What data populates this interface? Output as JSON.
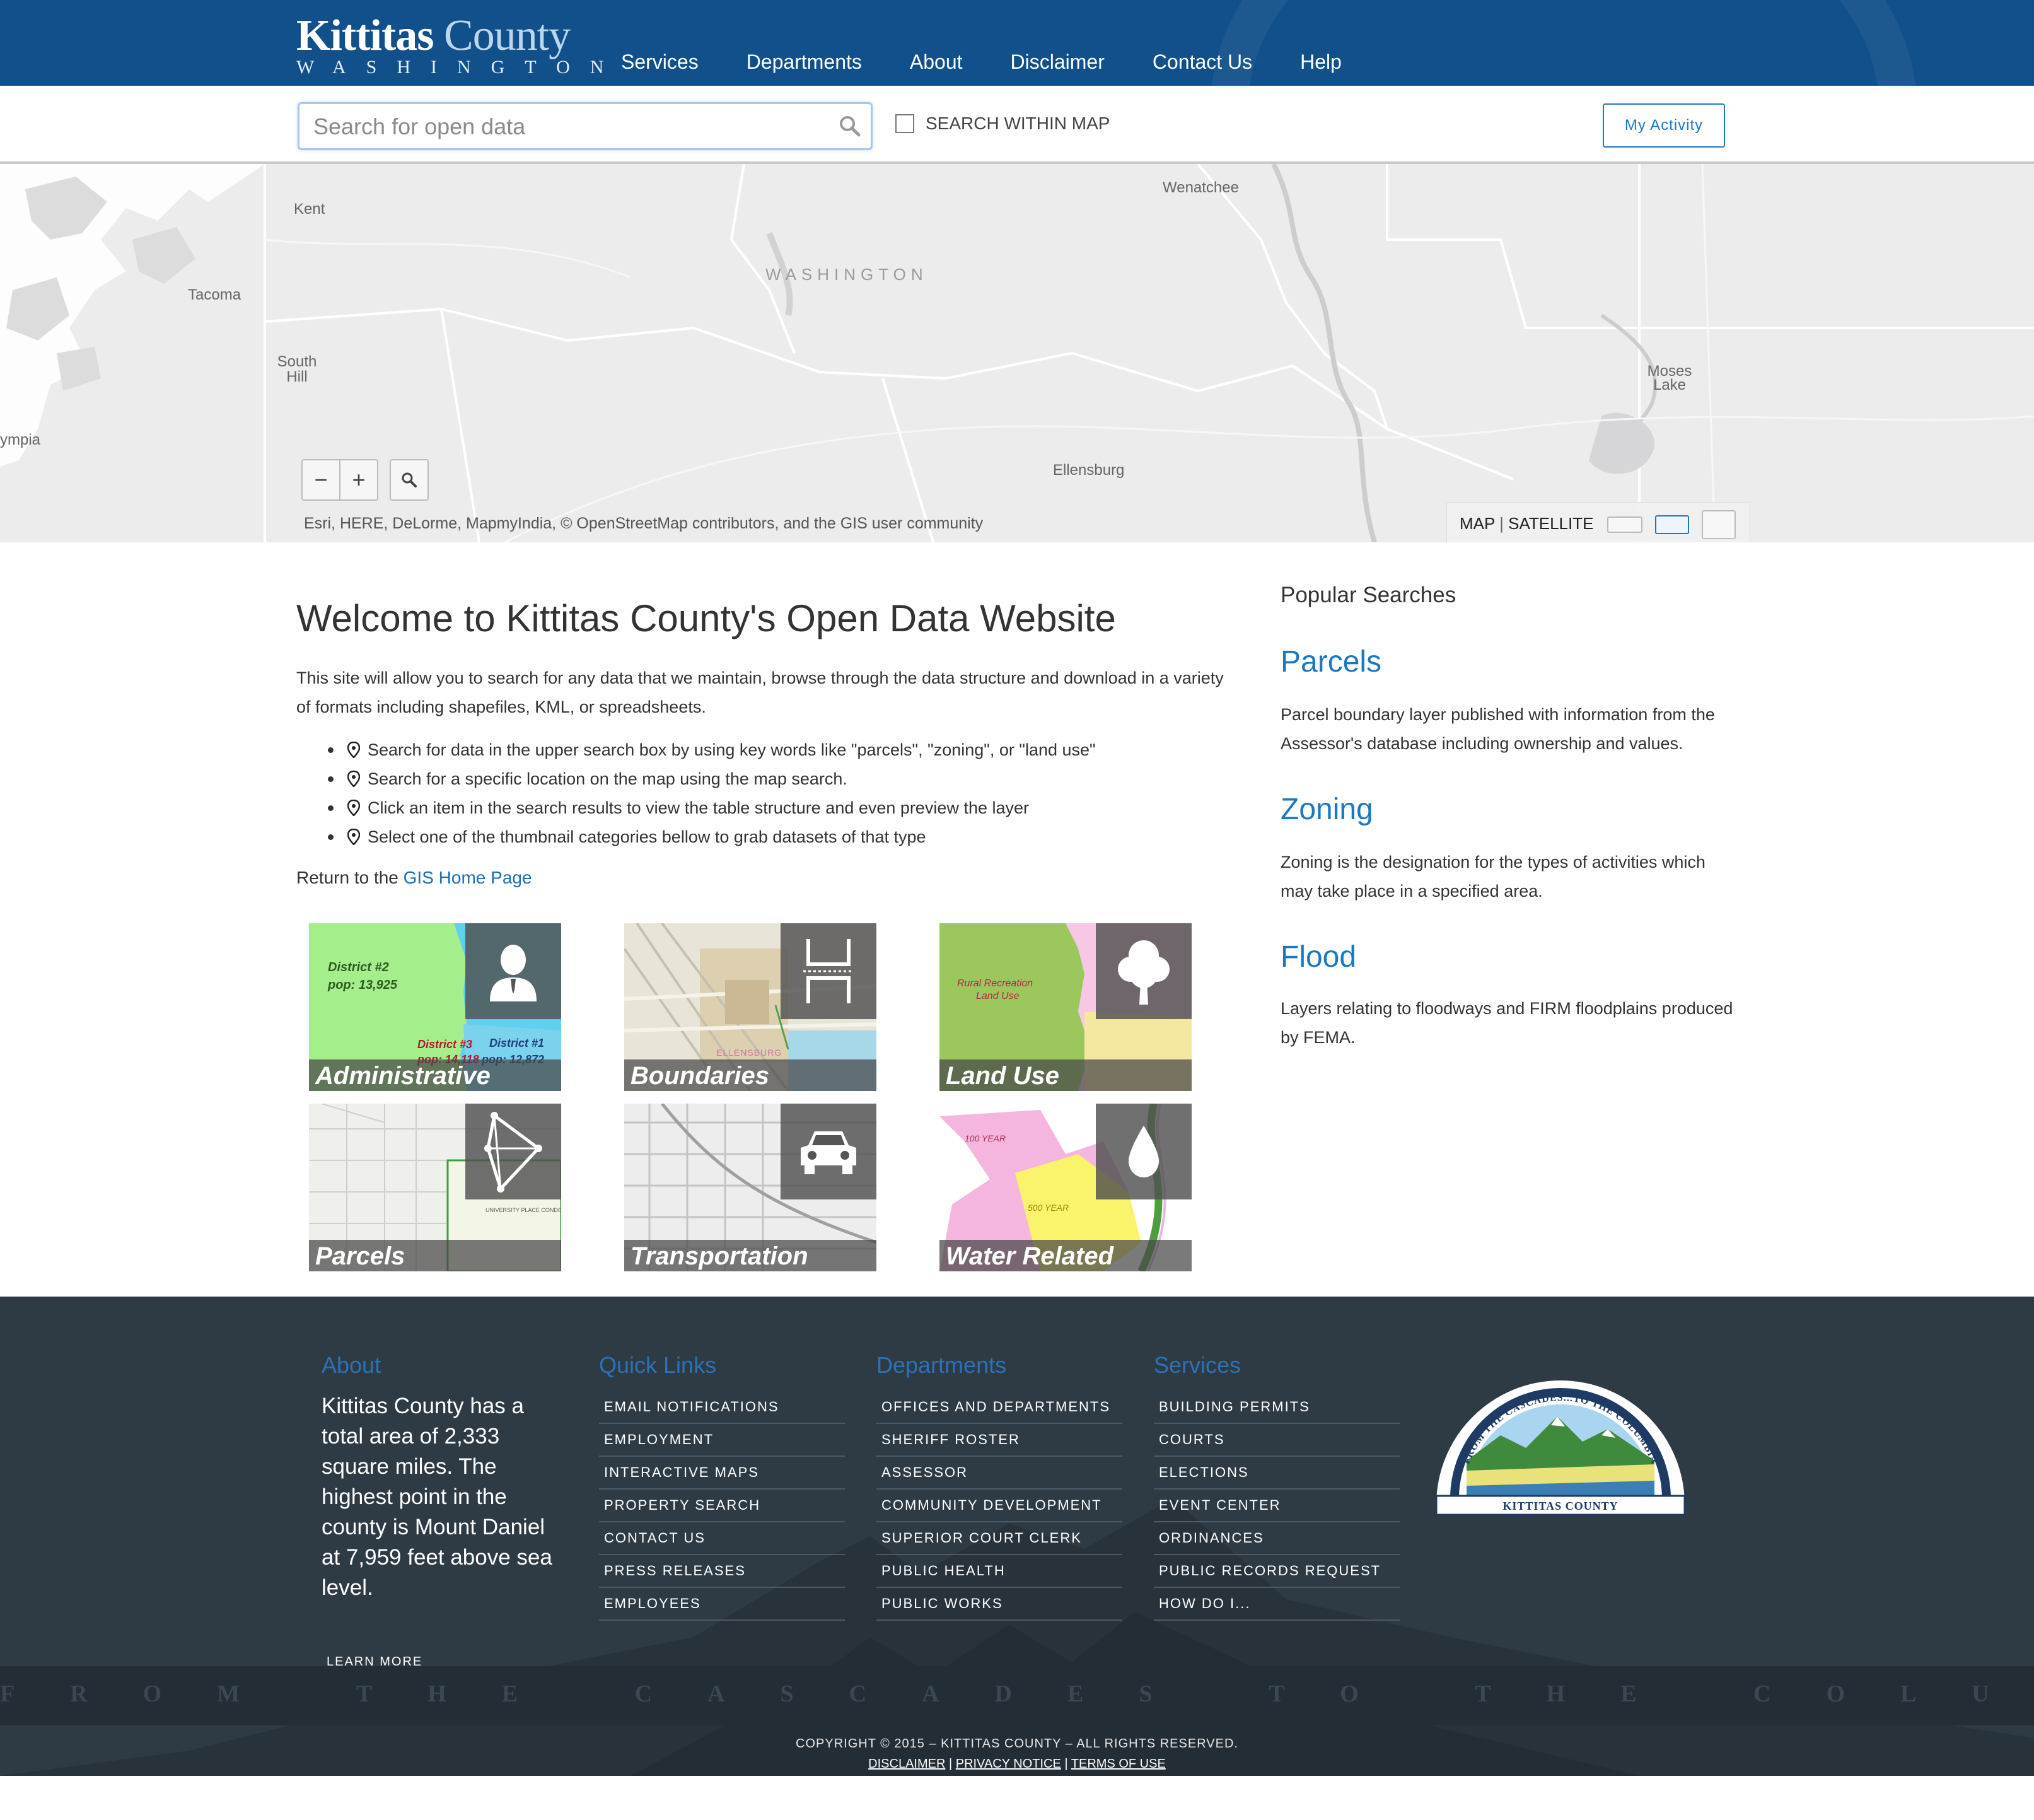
{
  "header": {
    "logo_title_1": "Kittitas",
    "logo_title_2": "County",
    "logo_subtitle": "WASHINGTON",
    "nav": [
      "Services",
      "Departments",
      "About",
      "Disclaimer",
      "Contact Us",
      "Help"
    ],
    "background_color": "#11508a"
  },
  "search": {
    "placeholder": "Search for open data",
    "within_map_label": "SEARCH WITHIN MAP",
    "within_map_checked": false,
    "activity_button": "My Activity"
  },
  "map": {
    "labels": {
      "kent": "Kent",
      "tacoma": "Tacoma",
      "south_hill": "South Hill",
      "olympia": "ympia",
      "washington": "WASHINGTON",
      "wenatchee": "Wenatchee",
      "ellensburg": "Ellensburg",
      "moses_lake": "Moses Lake"
    },
    "zoom_out": "−",
    "zoom_in": "+",
    "attribution": "Esri, HERE, DeLorme, MapmyIndia, © OpenStreetMap contributors, and the GIS user community",
    "basemap_map": "MAP",
    "basemap_separator": "|",
    "basemap_satellite": "SATELLITE"
  },
  "main": {
    "title": "Welcome to Kittitas County's Open Data Website",
    "intro": "This site will allow you to search for any data that we maintain, browse through the data structure and download in a variety of formats including shapefiles, KML, or spreadsheets.",
    "bullets": [
      "Search for data in the upper search box by using key words like \"parcels\", \"zoning\", or \"land use\"",
      "Search for a specific location on the map using the map search.",
      "Click an item in the search results to view the table structure and even preview the layer",
      "Select one of the thumbnail categories bellow to grab datasets of that type"
    ],
    "return_prefix": "Return to the",
    "return_link": "GIS Home Page",
    "categories": [
      {
        "label": "Administrative",
        "icon": "person-icon",
        "map_text": [
          "District #2",
          "pop: 13,925",
          "District #3",
          "District #1",
          "pop: 14,118",
          "pop: 12,872"
        ]
      },
      {
        "label": "Boundaries",
        "icon": "boundary-icon",
        "map_text": [
          "ELLENSBURG"
        ]
      },
      {
        "label": "Land Use",
        "icon": "tree-icon",
        "map_text": [
          "Rural Recreation",
          "Land Use"
        ]
      },
      {
        "label": "Parcels",
        "icon": "polygon-icon",
        "map_text": [
          "UNIVERSITY PLACE CONDO"
        ]
      },
      {
        "label": "Transportation",
        "icon": "car-icon",
        "map_text": []
      },
      {
        "label": "Water Related",
        "icon": "water-drop-icon",
        "map_text": [
          "100 YEAR",
          "500 YEAR"
        ]
      }
    ]
  },
  "popular": {
    "heading": "Popular Searches",
    "items": [
      {
        "title": "Parcels",
        "desc": "Parcel boundary layer published with information from the Assessor's database including ownership and values."
      },
      {
        "title": "Zoning",
        "desc": "Zoning is the designation for the types of activities which may take place in a specified area."
      },
      {
        "title": "Flood",
        "desc": "Layers relating to floodways and FIRM floodplains produced by FEMA."
      }
    ]
  },
  "footer": {
    "about_heading": "About",
    "about_text": "Kittitas County has a total area of 2,333 square miles. The highest point in the county is Mount Daniel at 7,959 feet above sea level.",
    "learn_more": "LEARN MORE",
    "quick_links_heading": "Quick Links",
    "quick_links": [
      "EMAIL NOTIFICATIONS",
      "EMPLOYMENT",
      "INTERACTIVE MAPS",
      "PROPERTY SEARCH",
      "CONTACT US",
      "PRESS RELEASES",
      "EMPLOYEES"
    ],
    "departments_heading": "Departments",
    "departments": [
      "OFFICES AND DEPARTMENTS",
      "SHERIFF ROSTER",
      "ASSESSOR",
      "COMMUNITY DEVELOPMENT",
      "SUPERIOR COURT CLERK",
      "PUBLIC HEALTH",
      "PUBLIC WORKS"
    ],
    "services_heading": "Services",
    "services": [
      "BUILDING PERMITS",
      "COURTS",
      "ELECTIONS",
      "EVENT CENTER",
      "ORDINANCES",
      "PUBLIC RECORDS REQUEST",
      "HOW DO I..."
    ],
    "seal_text_top": "FROM THE CASCADES...TO THE COLUMBIA",
    "seal_text_bottom": "KITTITAS COUNTY",
    "tagline": "FROM THE CASCADES TO THE COLUMBIA",
    "copyright": "COPYRIGHT © 2015 – KITTITAS COUNTY – ALL RIGHTS RESERVED.",
    "legal_links": [
      "DISCLAIMER",
      "PRIVACY NOTICE",
      "TERMS OF USE"
    ],
    "legal_separator": "|"
  },
  "colors": {
    "header_blue": "#11508a",
    "link_blue": "#1a78c2",
    "footer_bg": "#2e3a44",
    "footer_heading": "#2c72b8"
  }
}
